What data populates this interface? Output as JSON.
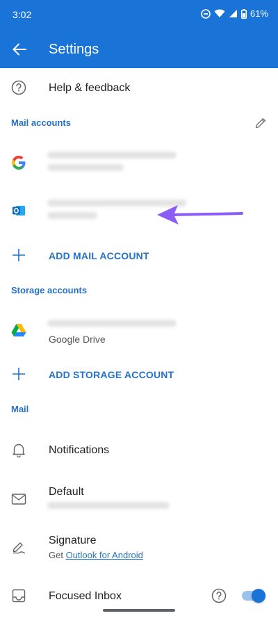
{
  "status_bar": {
    "time": "3:02",
    "battery": "61%"
  },
  "app_bar": {
    "title": "Settings"
  },
  "help": {
    "label": "Help & feedback"
  },
  "mail_accounts": {
    "section_title": "Mail accounts",
    "add_label": "ADD MAIL ACCOUNT"
  },
  "storage_accounts": {
    "section_title": "Storage accounts",
    "drive_subtitle": "Google Drive",
    "add_label": "ADD STORAGE ACCOUNT"
  },
  "mail": {
    "section_title": "Mail",
    "notifications_label": "Notifications",
    "default_label": "Default",
    "signature_label": "Signature",
    "signature_prefix": "Get ",
    "signature_link": "Outlook for Android",
    "focused_inbox_label": "Focused Inbox",
    "focused_inbox_enabled": true
  },
  "colors": {
    "brand_blue": "#1a73d6",
    "accent_text": "#2572c6",
    "annotation_arrow": "#8b5cf6"
  }
}
